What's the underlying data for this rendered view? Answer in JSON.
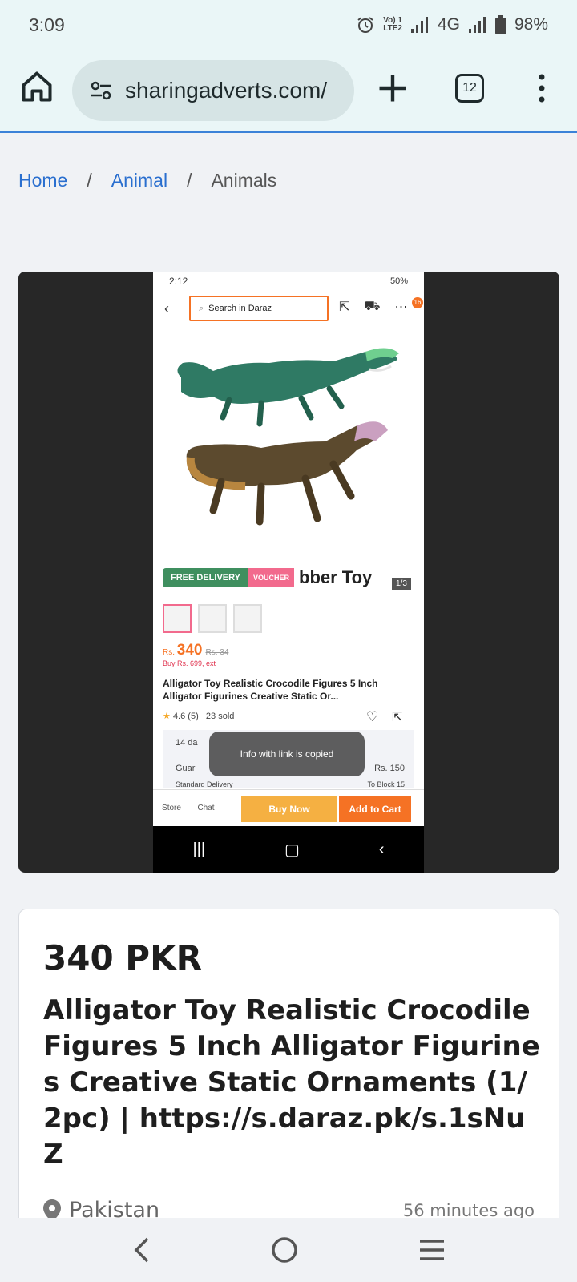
{
  "status_bar": {
    "time": "3:09",
    "volte_top": "Vo) 1",
    "volte_bottom": "LTE2",
    "network": "4G",
    "battery": "98%"
  },
  "browser": {
    "url": "sharingadverts.com/",
    "tab_count": "12"
  },
  "breadcrumb": {
    "items": [
      {
        "label": "Home"
      },
      {
        "label": "Animal"
      },
      {
        "label": "Animals"
      }
    ],
    "separator": "/"
  },
  "screenshot": {
    "time": "2:12",
    "battery": "50%",
    "search_placeholder": "Search in Daraz",
    "cart_badge": "16",
    "free_delivery": "FREE DELIVERY",
    "voucher": "VOUCHER",
    "rubber_toy": "bber Toy",
    "image_count": "1/3",
    "price_prefix": "Rs.",
    "price": "340",
    "old_price": "Rs. 34",
    "buy_offer": "Buy Rs. 699, ext",
    "title": "Alligator Toy Realistic Crocodile Figures 5 Inch Alligator Figurines Creative Static Or...",
    "rating": "4.6 (5)",
    "sold": "23 sold",
    "row1": "14 da",
    "row2": "Guar",
    "row2_price": "Rs. 150",
    "toast": "Info with link is copied",
    "standard_delivery": "Standard Delivery",
    "to_block": "To Block 15",
    "store": "Store",
    "chat": "Chat",
    "buy_now": "Buy Now",
    "add_to_cart": "Add to Cart"
  },
  "listing": {
    "price": "340 PKR",
    "title": "Alligator Toy Realistic Crocodile Figures 5 Inch Alligator Figurines Creative Static Ornaments (1/2pc) | https://s.daraz.pk/s.1sNuZ",
    "location": "Pakistan",
    "posted": "56 minutes ago"
  },
  "colors": {
    "link": "#2a6fcf",
    "accent_orange": "#f57224",
    "toolbar_bg": "#eaf6f7"
  }
}
